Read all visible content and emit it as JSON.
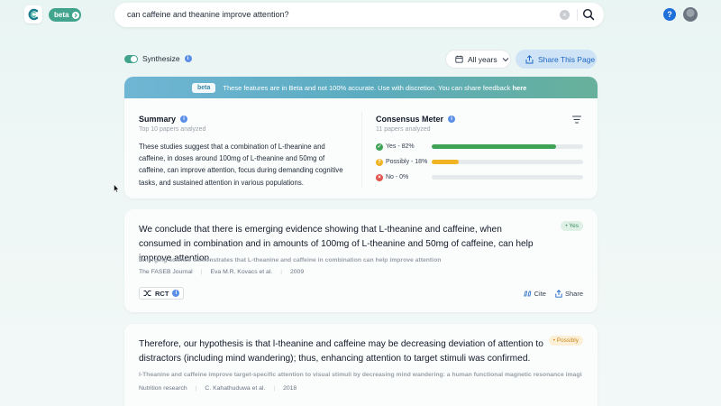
{
  "header": {
    "beta_label": "beta",
    "search_query": "can caffeine and theanine improve attention?",
    "help_label": "?"
  },
  "controls": {
    "synthesize_label": "Synthesize",
    "years_label": "All years",
    "share_label": "Share This Page"
  },
  "banner": {
    "tag": "beta",
    "text": "These features are in Beta and not 100% accurate. Use with discretion. You can share feedback",
    "link": "here"
  },
  "summary": {
    "title": "Summary",
    "subtitle": "Top 10 papers analyzed",
    "text": "These studies suggest that a combination of L-theanine and caffeine, in doses around 100mg of L-theanine and 50mg of caffeine, can improve attention, focus during demanding cognitive tasks, and sustained attention in various populations."
  },
  "meter": {
    "title": "Consensus Meter",
    "subtitle": "11 papers analyzed",
    "rows": [
      {
        "label": "Yes - 82%",
        "percent": 82,
        "color": "#3fa356",
        "icon": "check-icon"
      },
      {
        "label": "Possibly - 18%",
        "percent": 18,
        "color": "#f0b323",
        "icon": "possibly-icon"
      },
      {
        "label": "No - 0%",
        "percent": 0,
        "color": "#e0574f",
        "icon": "x-icon"
      }
    ]
  },
  "results": [
    {
      "claim": "We conclude that there is emerging evidence showing that L-theanine and caffeine, when consumed in combination and in amounts of 100mg of L-theanine and 50mg of caffeine, can help improve attention.",
      "badge": "• Yes",
      "takeaway": "Emerging science demonstrates that L-theanine and caffeine in combination can help improve attention",
      "journal": "The FASEB Journal",
      "authors": "Eva M.R. Kovacs et al.",
      "year": "2009",
      "study_type": "RCT",
      "cite": "Cite",
      "share": "Share"
    },
    {
      "claim": "Therefore, our hypothesis is that l-theanine and caffeine may be decreasing deviation of attention to distractors (including mind wandering); thus, enhancing attention to target stimuli was confirmed.",
      "badge": "• Possibly",
      "takeaway": "l-Theanine and caffeine improve target-specific attention to visual stimuli by decreasing mind wandering: a human functional magnetic resonance imagin...",
      "journal": "Nutrition research",
      "authors": "C. Kahathuduwa et al.",
      "year": "2018"
    }
  ]
}
